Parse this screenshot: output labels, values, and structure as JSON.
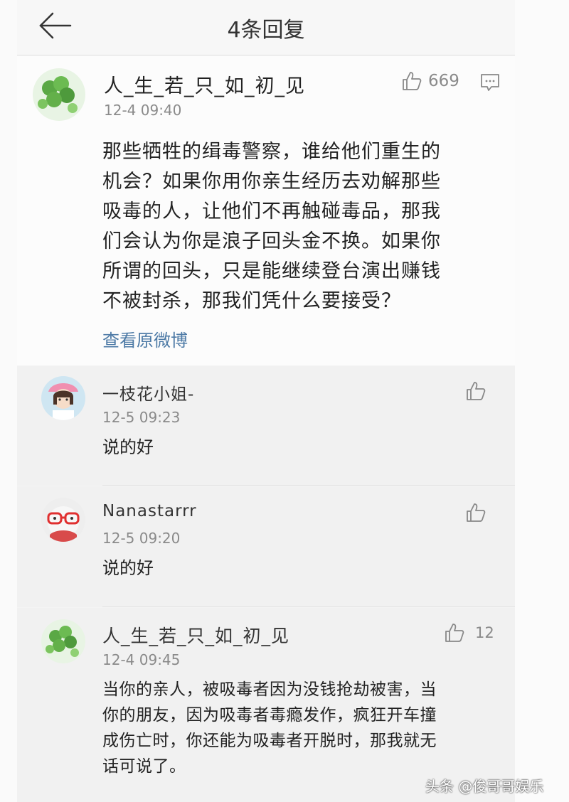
{
  "header": {
    "title": "4条回复"
  },
  "main_comment": {
    "username": "人_生_若_只_如_初_见",
    "time": "12-4 09:40",
    "likes": "669",
    "text_lines": [
      "那些牺牲的缉毒警察，谁给他们重生的",
      "机会？如果你用你亲生经历去劝解那些",
      "吸毒的人，让他们不再触碰毒品，那我",
      "们会认为你是浪子回头金不换。如果你",
      "所谓的回头，只是能继续登台演出赚钱",
      "不被封杀，那我们凭什么要接受？"
    ],
    "view_original": "查看原微博"
  },
  "replies": [
    {
      "username": "一枝花小姐-",
      "time": "12-5 09:23",
      "text_lines": [
        "说的好"
      ]
    },
    {
      "username": "Nanastarrr",
      "time": "12-5 09:20",
      "text_lines": [
        "说的好"
      ]
    },
    {
      "username": "人_生_若_只_如_初_见",
      "time": "12-4 09:45",
      "likes": "12",
      "text_lines": [
        "当你的亲人，被吸毒者因为没钱抢劫被害，当",
        "你的朋友，因为吸毒者毒瘾发作，疯狂开车撞",
        "成伤亡时，你还能为吸毒者开脱时，那我就无",
        "话可说了。"
      ]
    }
  ],
  "watermark": "头条 @俊哥哥娱乐",
  "icons": {
    "back": "back-arrow-icon",
    "like": "thumbs-up-icon",
    "reply": "comment-icon"
  },
  "colors": {
    "link": "#4d7aa6",
    "meta": "#8a8a8a"
  }
}
